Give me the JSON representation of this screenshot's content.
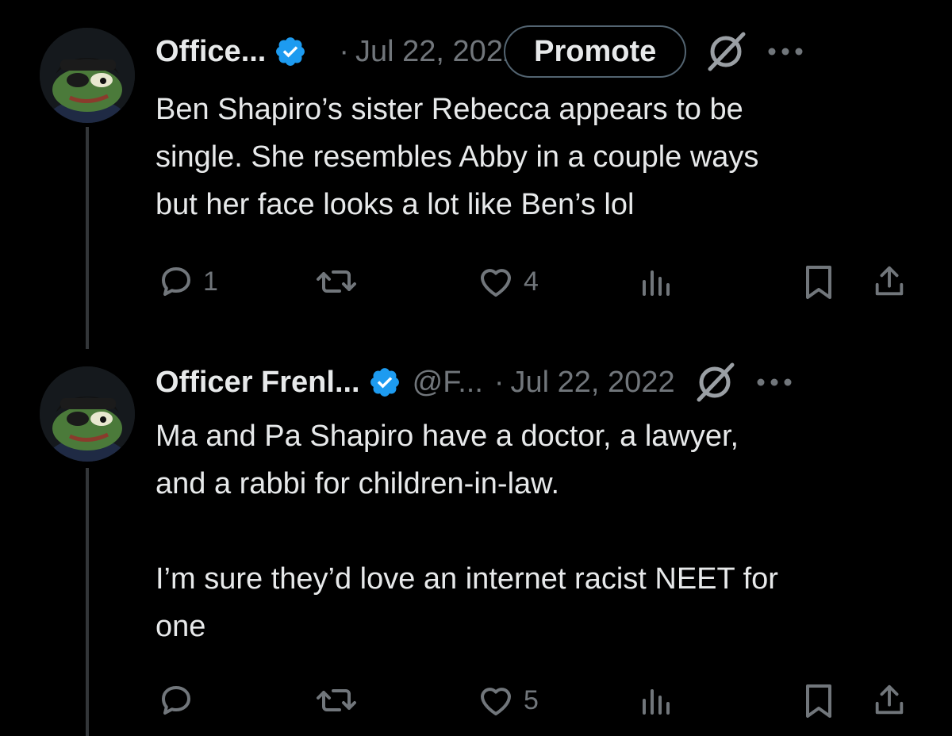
{
  "tweets": [
    {
      "display_name": "Office...",
      "handle": "",
      "separator": "·",
      "date": "Jul 22, 2022",
      "promote_label": "Promote",
      "text_lines": [
        "Ben Shapiro’s sister Rebecca appears to be",
        "single. She resembles Abby in a couple ways",
        "but her face looks a lot like Ben’s lol"
      ],
      "replies": "1",
      "retweets": "",
      "likes": "4",
      "views": ""
    },
    {
      "display_name": "Officer Frenl...",
      "handle": "@F...",
      "separator": "·",
      "date": "Jul 22, 2022",
      "text_lines": [
        "Ma and Pa Shapiro have a doctor, a lawyer,",
        "and a rabbi for children-in-law.",
        "",
        "I’m sure they’d love an internet racist NEET for",
        "one"
      ],
      "replies": "",
      "retweets": "",
      "likes": "5",
      "views": ""
    }
  ],
  "icons": {
    "verified": "verified-badge-icon",
    "grok": "grok-icon",
    "more": "more-icon",
    "reply": "reply-icon",
    "retweet": "retweet-icon",
    "like": "like-icon",
    "views": "views-icon",
    "bookmark": "bookmark-icon",
    "share": "share-icon"
  },
  "colors": {
    "background": "#000000",
    "text": "#e7e9ea",
    "muted": "#71767b",
    "verified": "#1d9bf0",
    "thread_line": "#333639"
  }
}
